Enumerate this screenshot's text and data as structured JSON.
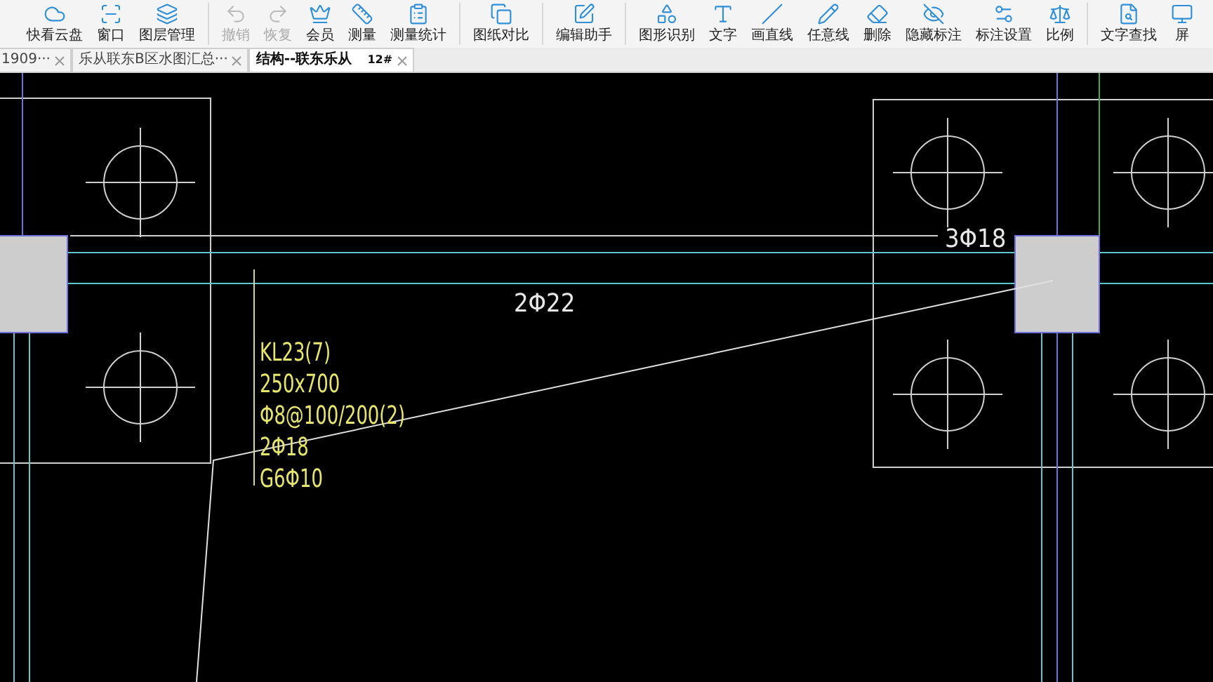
{
  "toolbar": [
    {
      "kind": "button",
      "label": "快看云盘",
      "disabled": false
    },
    {
      "kind": "button",
      "label": "窗口",
      "disabled": false
    },
    {
      "kind": "button",
      "label": "图层管理",
      "disabled": false
    },
    {
      "kind": "separator"
    },
    {
      "kind": "button",
      "label": "撤销",
      "disabled": true
    },
    {
      "kind": "button",
      "label": "恢复",
      "disabled": true
    },
    {
      "kind": "button",
      "label": "会员",
      "disabled": false
    },
    {
      "kind": "button",
      "label": "测量",
      "disabled": false
    },
    {
      "kind": "button",
      "label": "测量统计",
      "disabled": false
    },
    {
      "kind": "separator"
    },
    {
      "kind": "button",
      "label": "图纸对比",
      "disabled": false
    },
    {
      "kind": "separator"
    },
    {
      "kind": "button",
      "label": "编辑助手",
      "disabled": false
    },
    {
      "kind": "separator"
    },
    {
      "kind": "button",
      "label": "图形识别",
      "disabled": false
    },
    {
      "kind": "button",
      "label": "文字",
      "disabled": false
    },
    {
      "kind": "button",
      "label": "画直线",
      "disabled": false
    },
    {
      "kind": "button",
      "label": "任意线",
      "disabled": false
    },
    {
      "kind": "button",
      "label": "删除",
      "disabled": false
    },
    {
      "kind": "button",
      "label": "隐藏标注",
      "disabled": false
    },
    {
      "kind": "button",
      "label": "标注设置",
      "disabled": false
    },
    {
      "kind": "button",
      "label": "比例",
      "disabled": false
    },
    {
      "kind": "separator"
    },
    {
      "kind": "button",
      "label": "文字查找",
      "disabled": false
    },
    {
      "kind": "button",
      "label": "屏",
      "disabled": false
    }
  ],
  "tabs": [
    {
      "label": "1909···",
      "selected": false
    },
    {
      "label": "乐从联东B区水图汇总···",
      "selected": false
    },
    {
      "label": "结构--联东乐从",
      "badge": "12#",
      "selected": true
    }
  ],
  "drawing": {
    "bar_labels": [
      {
        "text": "2Φ22"
      },
      {
        "text": "3Φ18"
      }
    ],
    "beam_annotation": [
      "KL23(7)",
      "250x700",
      "Φ8@100/200(2)",
      "2Φ18",
      "G6Φ10"
    ]
  }
}
